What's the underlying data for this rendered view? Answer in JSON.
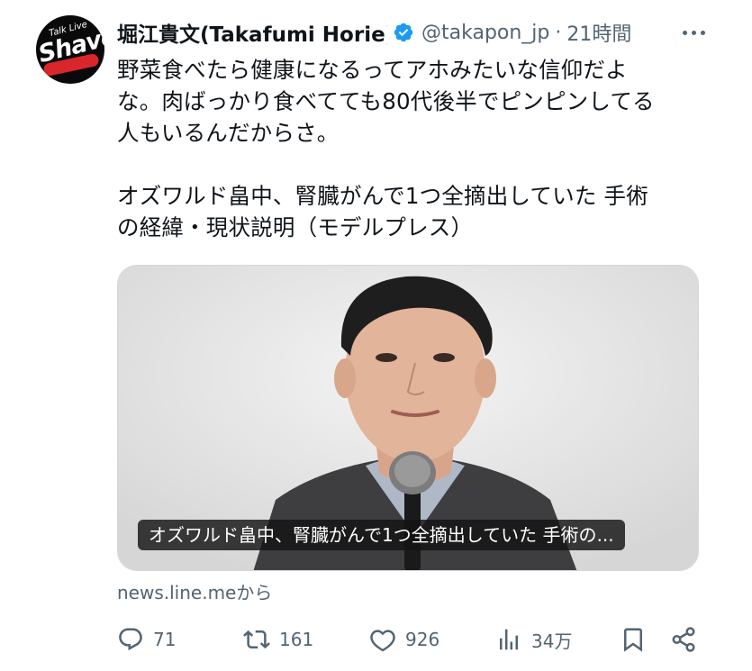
{
  "user": {
    "display_name": "堀江貴文(Takafumi Horie)",
    "handle": "@takapon_jp",
    "time": "21時間",
    "separator": "·",
    "verified": true,
    "avatar_logo": {
      "top": "Talk Live",
      "main": "Shave"
    }
  },
  "tweet": {
    "text": "野菜食べたら健康になるってアホみたいな信仰だよ\nな。肉ばっかり食べてても80代後半でピンピンしてる\n人もいるんだからさ。\n\nオズワルド畠中、腎臓がんで1つ全摘出していた 手術\nの経緯・現状説明（モデルプレス）"
  },
  "link_card": {
    "caption": "オズワルド畠中、腎臓がんで1つ全摘出していた 手術の...",
    "source": "news.line.meから"
  },
  "actions": {
    "replies": "71",
    "retweets": "161",
    "likes": "926",
    "views": "34万"
  },
  "colors": {
    "secondary_text": "#536471",
    "verified_blue": "#1d9bf0",
    "border": "#cfd9de"
  }
}
